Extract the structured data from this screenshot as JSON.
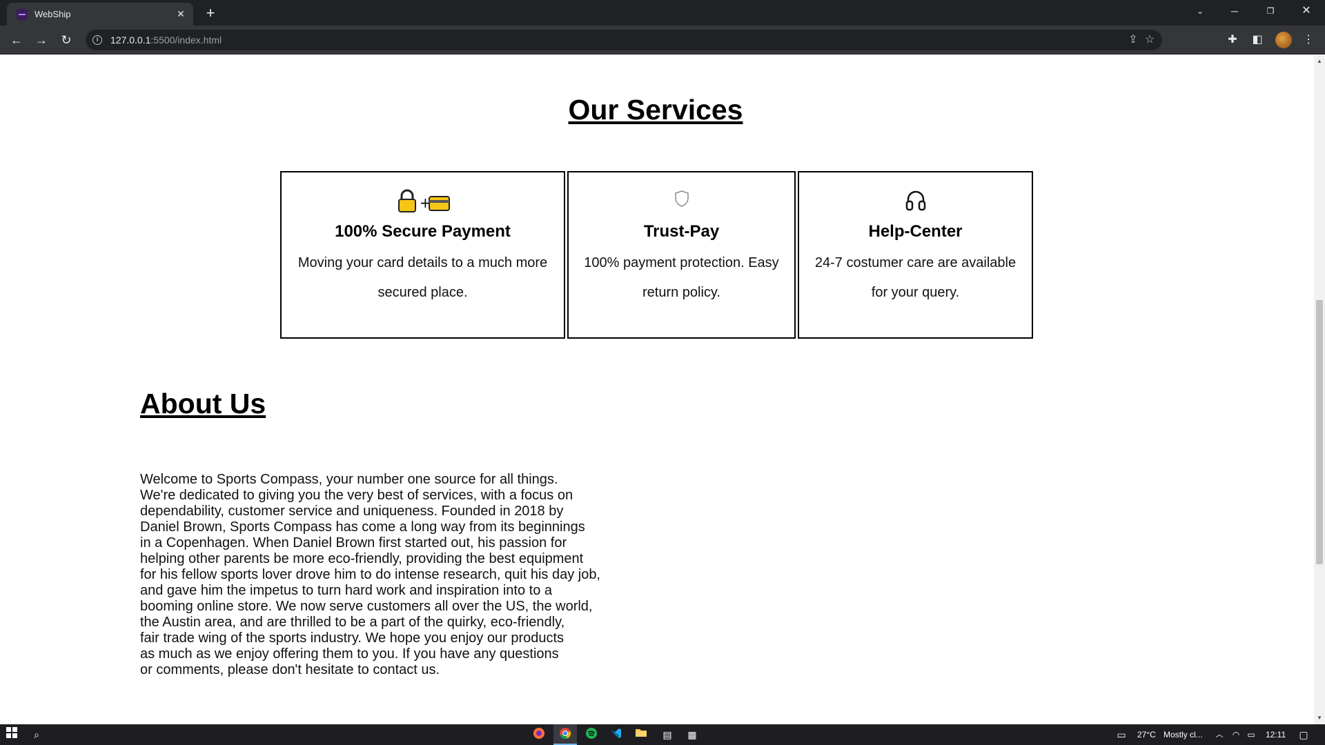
{
  "browser": {
    "tab_title": "WebShip",
    "tab_close": "✕",
    "new_tab": "+",
    "url_host": "127.0.0.1",
    "url_path": ":5500/index.html"
  },
  "services": {
    "heading": "Our Services",
    "cards": [
      {
        "icon": "lock-and-card-icon",
        "title": "100% Secure Payment",
        "text": "Moving your card details to a much more secured place."
      },
      {
        "icon": "shield-icon",
        "title": "Trust-Pay",
        "text": "100% payment protection. Easy return policy."
      },
      {
        "icon": "headphones-icon",
        "title": "Help-Center",
        "text": "24-7 costumer care are available for your query."
      }
    ]
  },
  "about": {
    "heading": "About Us",
    "text": "Welcome to Sports Compass, your number one source for all things.\nWe're dedicated to giving you the very best of services, with a focus on\ndependability, customer service and uniqueness. Founded in 2018 by\nDaniel Brown, Sports Compass has come a long way from its beginnings\nin a Copenhagen. When Daniel Brown first started out, his passion for\nhelping other parents be more eco-friendly, providing the best equipment\nfor his fellow sports lover drove him to do intense research, quit his day job,\nand gave him the impetus to turn hard work and inspiration into to a\nbooming online store. We now serve customers all over the US, the world,\nthe Austin area, and are thrilled to be a part of the quirky, eco-friendly,\nfair trade wing of the sports industry. We hope you enjoy our products\nas much as we enjoy offering them to you. If you have any questions\nor comments, please don't hesitate to contact us."
  },
  "taskbar": {
    "weather": "27°C",
    "weather_desc": "Mostly cl...",
    "time": "12:11"
  }
}
